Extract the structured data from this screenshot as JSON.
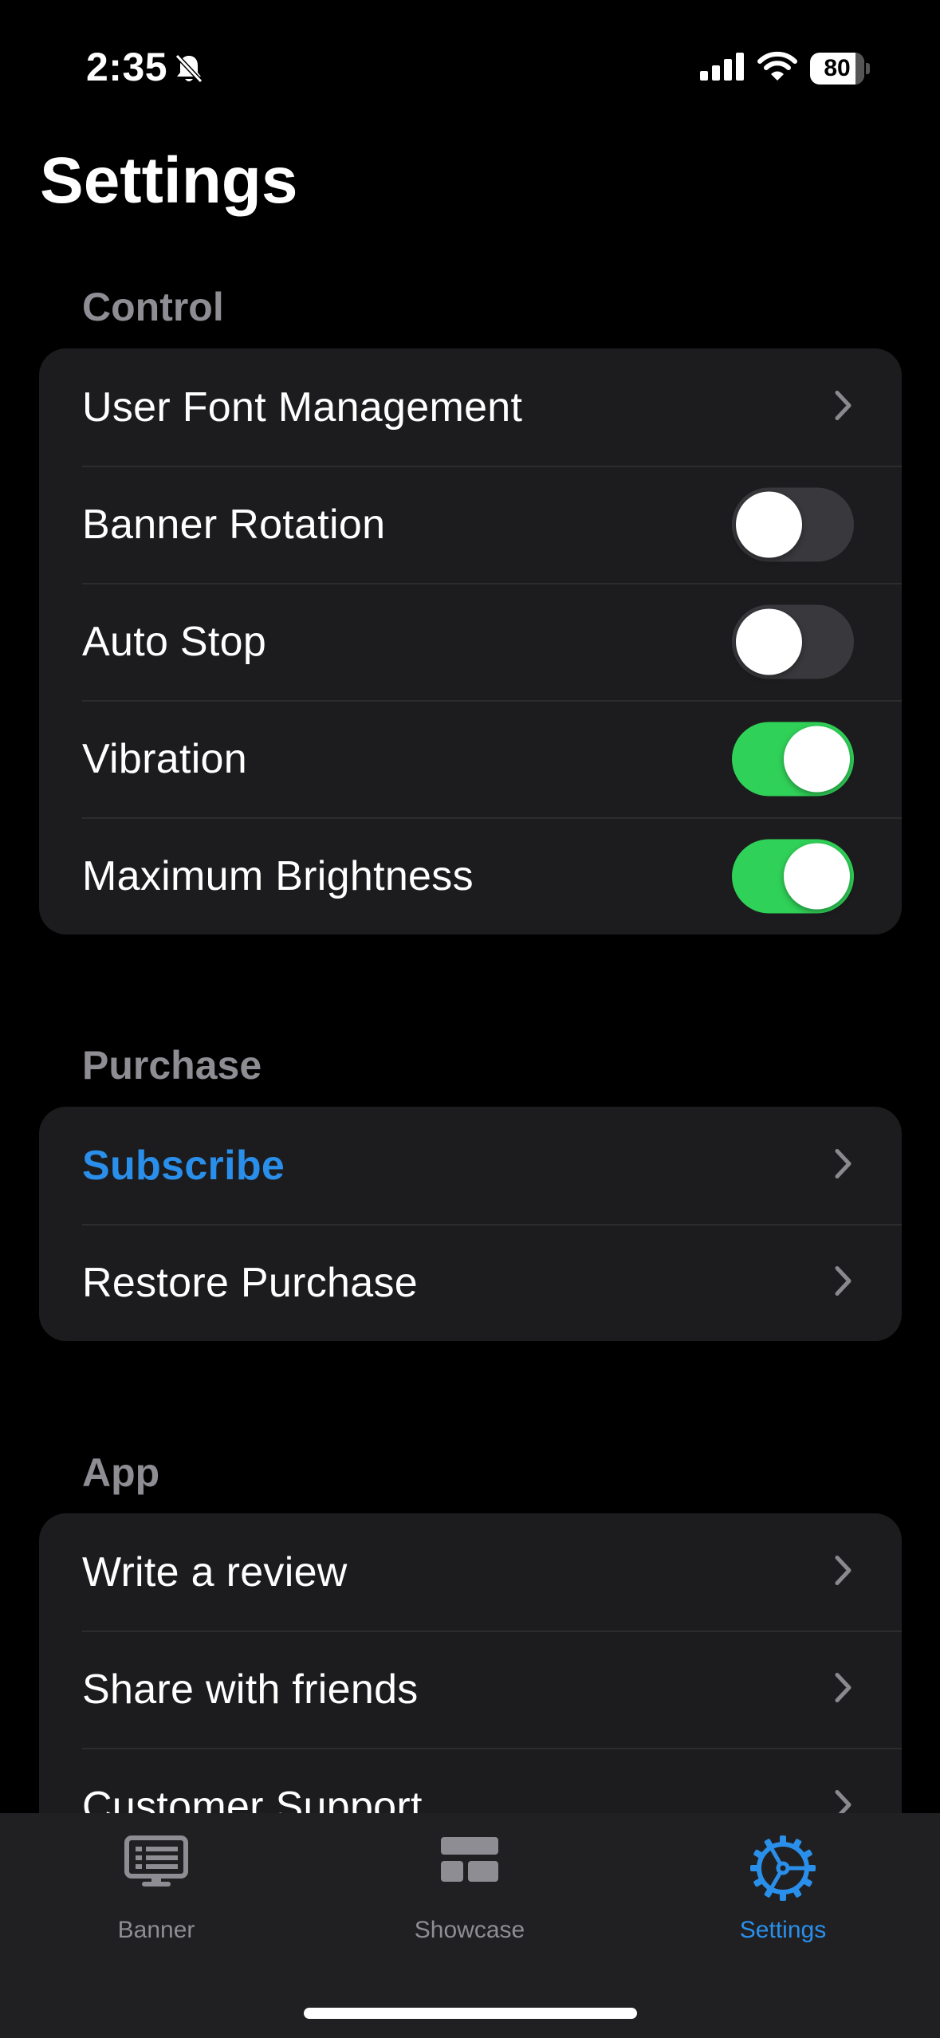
{
  "status_bar": {
    "time": "2:35",
    "battery": "80"
  },
  "title": "Settings",
  "sections": {
    "control": {
      "header": "Control",
      "items": [
        {
          "label": "User Font Management",
          "type": "link"
        },
        {
          "label": "Banner Rotation",
          "type": "toggle",
          "on": false
        },
        {
          "label": "Auto Stop",
          "type": "toggle",
          "on": false
        },
        {
          "label": "Vibration",
          "type": "toggle",
          "on": true
        },
        {
          "label": "Maximum Brightness",
          "type": "toggle",
          "on": true
        }
      ]
    },
    "purchase": {
      "header": "Purchase",
      "items": [
        {
          "label": "Subscribe",
          "type": "link"
        },
        {
          "label": "Restore Purchase",
          "type": "link"
        }
      ]
    },
    "app": {
      "header": "App",
      "items": [
        {
          "label": "Write a review",
          "type": "link"
        },
        {
          "label": "Share with friends",
          "type": "link"
        },
        {
          "label": "Customer Support",
          "type": "link"
        }
      ]
    }
  },
  "tab_bar": {
    "tabs": [
      {
        "label": "Banner",
        "icon": "banner-icon",
        "active": false
      },
      {
        "label": "Showcase",
        "icon": "showcase-icon",
        "active": false
      },
      {
        "label": "Settings",
        "icon": "settings-gear-icon",
        "active": true
      }
    ]
  },
  "colors": {
    "accent": "#2a8fea",
    "toggle_on": "#30d158",
    "toggle_off": "#39393d",
    "cell_bg": "#1c1c1e",
    "section_header": "#8d8d93"
  }
}
